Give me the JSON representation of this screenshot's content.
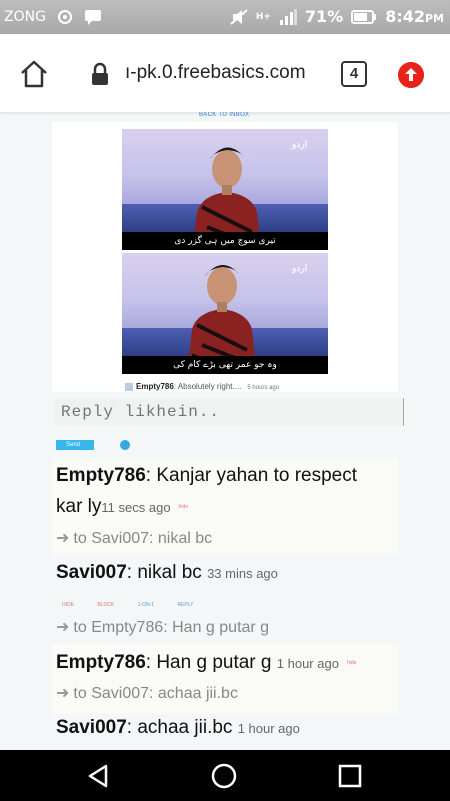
{
  "status_bar": {
    "carrier": "ZONG",
    "battery": "71%",
    "time": "8:42",
    "time_suffix": "PM",
    "network": "H+"
  },
  "browser": {
    "url": "ı-pk.0.freebasics.com",
    "tab_count": "4"
  },
  "post": {
    "back_link": "BACK TO INBOX",
    "caption_top": "تیری سوچ میں ہی گزر دی",
    "caption_bottom": "وہ جو عمر تھی بڑے کام کی",
    "logo_text": "اردو",
    "author": "Empty786",
    "excerpt": ": Absolutely right....",
    "time": "5 hours ago"
  },
  "reply": {
    "placeholder": "Reply likhein..",
    "send_label": "Send"
  },
  "messages": [
    {
      "author": "Empty786",
      "text": ": Kanjar yahan to respect",
      "text2": "kar ly",
      "time": "11 secs ago",
      "tag": "hide",
      "to": "to Savi007: nikal bc"
    },
    {
      "author": "Savi007",
      "text": ": nikal bc",
      "time": "33 mins ago",
      "actions": [
        "HIDE",
        "BLOCK",
        "1-ON-1",
        "REPLY"
      ],
      "to": "to Empty786: Han g putar g"
    },
    {
      "author": "Empty786",
      "text": ": Han g putar g",
      "time": "1 hour ago",
      "tag": "hide",
      "to": "to Savi007: achaa jii.bc"
    },
    {
      "author": "Savi007",
      "text": ": achaa jii.bc",
      "time": "1 hour ago"
    }
  ],
  "colors": {
    "send": "#38b6e9",
    "update": "#e8231c",
    "link": "#2f7fd0"
  }
}
